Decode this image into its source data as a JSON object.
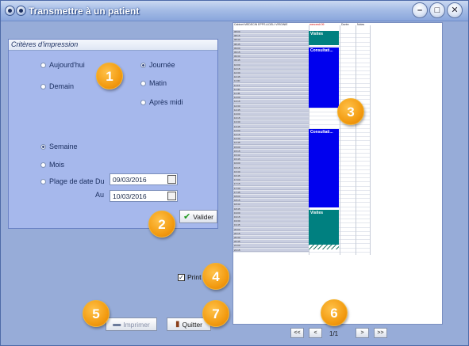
{
  "window": {
    "title": "Transmettre à un patient"
  },
  "criteria": {
    "header": "Critères d'impression",
    "day_options": [
      "Aujourd'hui",
      "Demain"
    ],
    "period_options": [
      "Journée",
      "Matin",
      "Après midi"
    ],
    "range_options": [
      "Semaine",
      "Mois",
      "Plage de date"
    ],
    "selected_period": "Journée",
    "selected_range": "Semaine",
    "from_label": "Du",
    "to_label": "Au",
    "from_date": "09/03/2016",
    "to_date": "10/03/2016",
    "validate_label": "Valider"
  },
  "print_option": {
    "label": "Print",
    "checked": true
  },
  "actions": {
    "print_label": "Imprimer",
    "quit_label": "Quitter"
  },
  "preview": {
    "header_left": "Cabinet MEDECIN EPPS A DELI VIRGINIE",
    "header_day": "mercredi 09",
    "header_cols": [
      "Durée",
      "Notes"
    ],
    "appointments": [
      {
        "label": "Visites",
        "color": "#008080"
      },
      {
        "label": "Consultati...",
        "color": "#0000ee"
      },
      {
        "label": "Consultati...",
        "color": "#0000ee"
      },
      {
        "label": "Visites",
        "color": "#008080"
      }
    ],
    "times": [
      "08:00",
      "08:15",
      "08:30",
      "08:45",
      "09:00",
      "09:15",
      "09:30",
      "09:45",
      "10:00",
      "10:15",
      "10:30",
      "10:45",
      "11:00",
      "11:15",
      "11:30",
      "11:45",
      "12:00",
      "12:15",
      "12:30",
      "12:45",
      "13:00",
      "13:15",
      "13:30",
      "13:45",
      "14:00",
      "14:15",
      "14:30",
      "14:45",
      "15:00",
      "15:15",
      "15:30",
      "15:45",
      "16:00",
      "16:15",
      "16:30",
      "16:45",
      "17:00",
      "17:15",
      "17:30",
      "17:45",
      "18:00",
      "18:15",
      "18:30",
      "18:45",
      "19:00",
      "19:15",
      "19:30",
      "19:45",
      "20:00",
      "20:15",
      "20:30",
      "20:45",
      "21:00",
      "21:15"
    ]
  },
  "pager": {
    "first": "<<",
    "prev": "<",
    "next": ">",
    "last": ">>",
    "page_text": "1/1"
  },
  "badges": [
    "1",
    "2",
    "3",
    "4",
    "5",
    "6",
    "7"
  ],
  "colors": {
    "window_bg": "#97acd8",
    "panel_bg": "#a6b8ec",
    "badge": "#f39c12"
  }
}
